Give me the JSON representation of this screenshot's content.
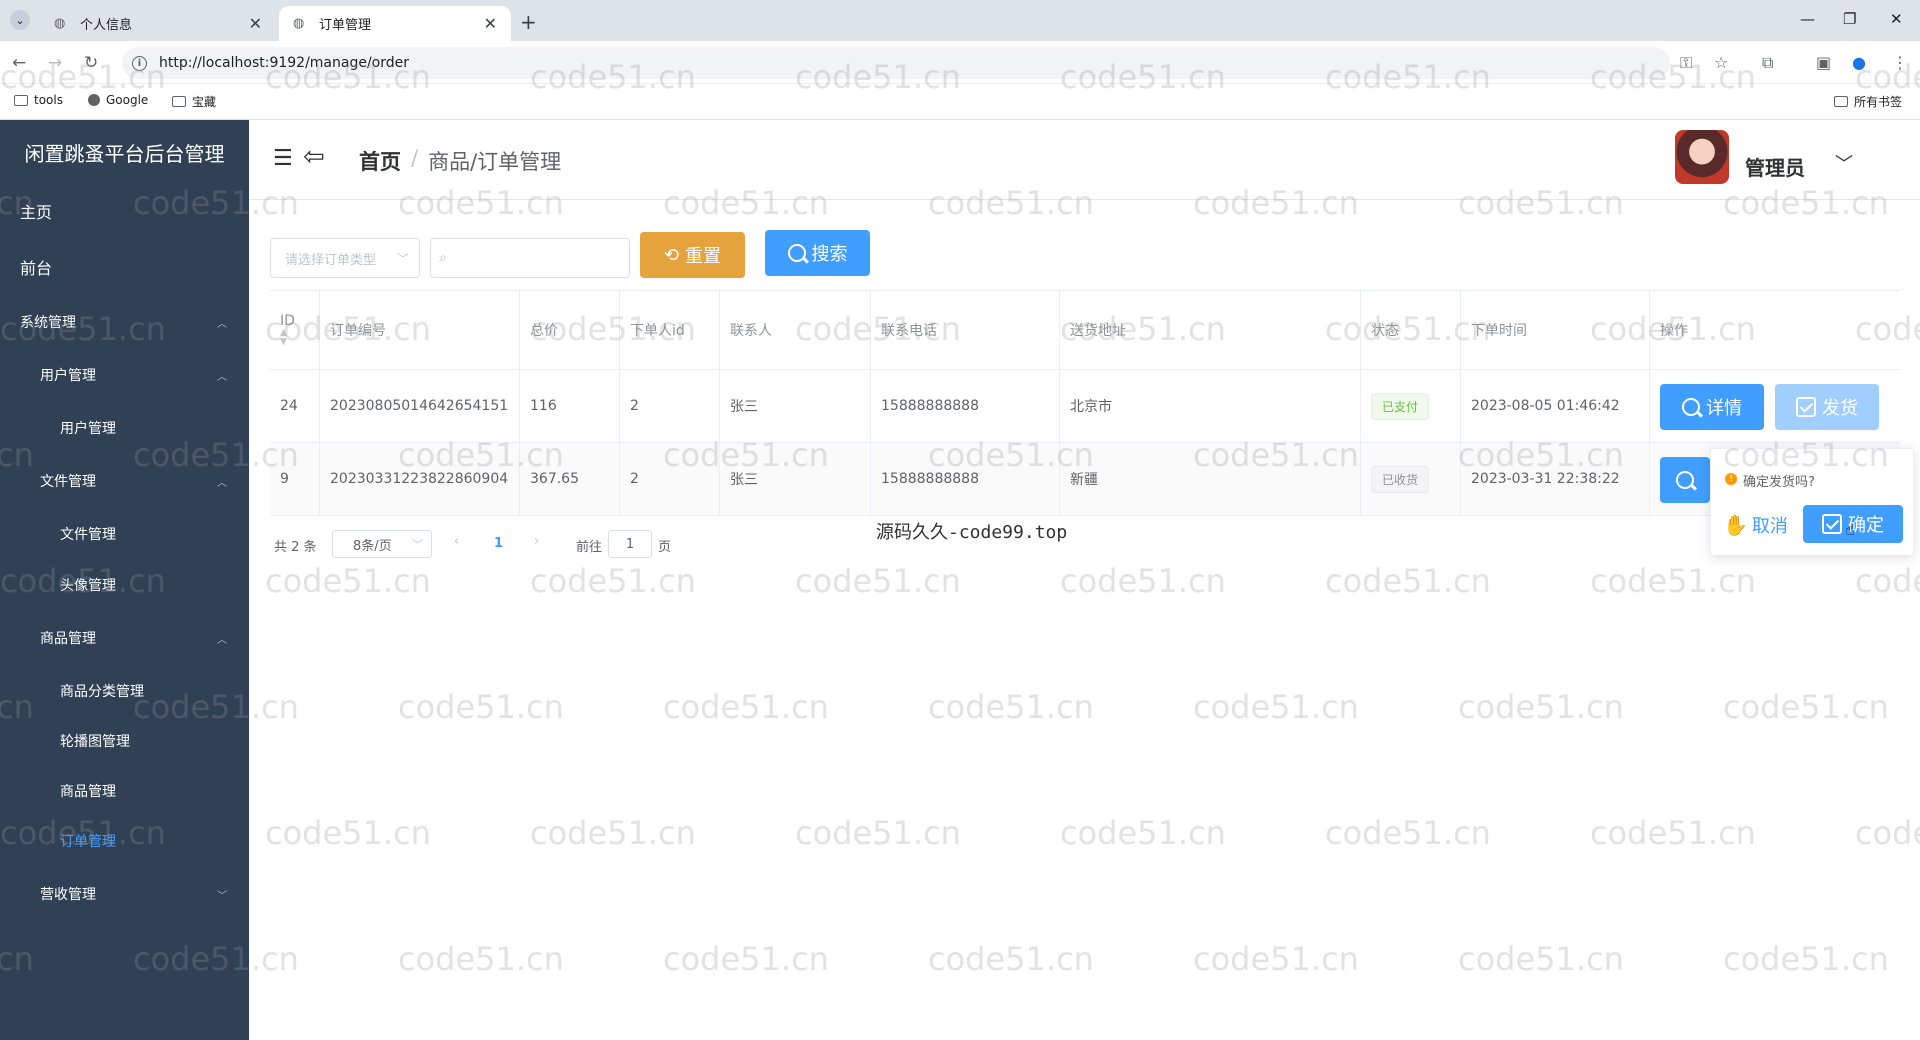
{
  "browser": {
    "tabs": [
      {
        "title": "个人信息"
      },
      {
        "title": "订单管理"
      }
    ],
    "url": "http://localhost:9192/manage/order",
    "bookmarks": [
      "tools",
      "Google",
      "宝藏"
    ],
    "all_bookmarks": "所有书签"
  },
  "sidebar": {
    "title": "闲置跳蚤平台后台管理",
    "items": [
      {
        "label": "主页"
      },
      {
        "label": "前台"
      },
      {
        "label": "系统管理"
      },
      {
        "label": "用户管理"
      },
      {
        "label": "用户管理"
      },
      {
        "label": "文件管理"
      },
      {
        "label": "文件管理"
      },
      {
        "label": "头像管理"
      },
      {
        "label": "商品管理"
      },
      {
        "label": "商品分类管理"
      },
      {
        "label": "轮播图管理"
      },
      {
        "label": "商品管理"
      },
      {
        "label": "订单管理"
      },
      {
        "label": "营收管理"
      }
    ]
  },
  "header": {
    "breadcrumb_home": "首页",
    "breadcrumb_sep": "/",
    "breadcrumb_current": "商品/订单管理",
    "user_name": "管理员"
  },
  "toolbar": {
    "type_placeholder": "请选择订单类型",
    "reset_label": "重置",
    "search_label": "搜索"
  },
  "table": {
    "columns": [
      "ID",
      "订单编号",
      "总价",
      "下单人id",
      "联系人",
      "联系电话",
      "送货地址",
      "状态",
      "下单时间",
      "操作"
    ],
    "rows": [
      {
        "id": "24",
        "order_no": "20230805014642654151",
        "total": "116",
        "user_id": "2",
        "contact": "张三",
        "phone": "15888888888",
        "address": "北京市",
        "status": "已支付",
        "time": "2023-08-05 01:46:42"
      },
      {
        "id": "9",
        "order_no": "20230331223822860904",
        "total": "367.65",
        "user_id": "2",
        "contact": "张三",
        "phone": "15888888888",
        "address": "新疆",
        "status": "已收货",
        "time": "2023-03-31 22:38:22"
      }
    ],
    "detail_label": "详情",
    "ship_label": "发货"
  },
  "pagination": {
    "total_text": "共 2 条",
    "page_size": "8条/页",
    "current_page": "1",
    "goto_prefix": "前往",
    "goto_value": "1",
    "goto_suffix": "页"
  },
  "popconfirm": {
    "text": "确定发货吗?",
    "cancel_label": "取消",
    "confirm_label": "确定"
  },
  "banner": "源码久久-code99.top",
  "watermark": "code51.cn",
  "colors": {
    "sidebar": "#304156",
    "primary": "#409eff",
    "warning": "#e6a23c",
    "success": "#67c23a"
  }
}
